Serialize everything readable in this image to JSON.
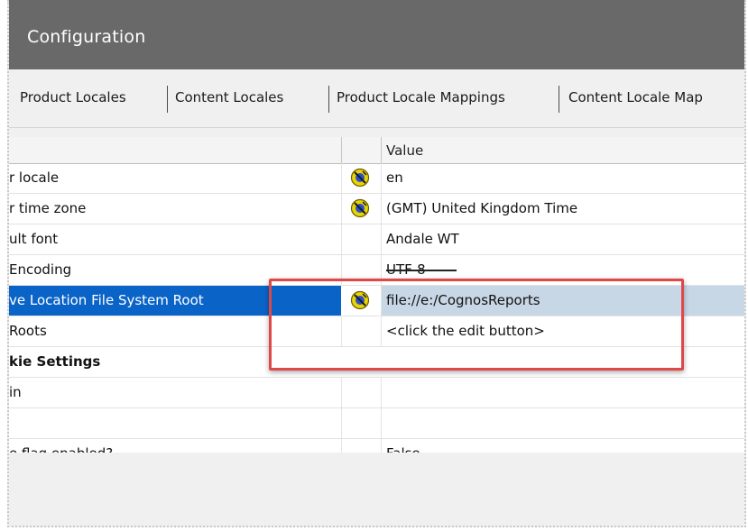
{
  "window": {
    "title": "Configuration"
  },
  "tabs": [
    {
      "label": "Product Locales"
    },
    {
      "label": "Content Locales"
    },
    {
      "label": "Product Locale Mappings"
    },
    {
      "label": "Content Locale Map"
    }
  ],
  "grid": {
    "value_header": "Value",
    "rows": [
      {
        "name": "r locale",
        "value": "en",
        "icon": "settings-edit-icon",
        "bold": false,
        "selected": false
      },
      {
        "name": "r time zone",
        "value": "(GMT) United Kingdom Time",
        "icon": "settings-edit-icon",
        "bold": false,
        "selected": false
      },
      {
        "name": "ult font",
        "value": "Andale WT",
        "icon": "",
        "bold": false,
        "selected": false
      },
      {
        "name": "Encoding",
        "value": "UTF-8",
        "icon": "",
        "bold": false,
        "selected": false
      },
      {
        "name": "ve Location File System Root",
        "value": "file://e:/CognosReports",
        "icon": "settings-edit-icon",
        "bold": false,
        "selected": true
      },
      {
        "name": "Roots",
        "value": "<click the edit button>",
        "icon": "",
        "bold": false,
        "selected": false
      },
      {
        "name": "kie Settings",
        "value": "",
        "icon": "",
        "bold": true,
        "selected": false
      },
      {
        "name": "in",
        "value": "",
        "icon": "",
        "bold": false,
        "selected": false
      },
      {
        "name": "",
        "value": "",
        "icon": "",
        "bold": false,
        "selected": false
      },
      {
        "name": "e flag enabled?",
        "value": "False",
        "icon": "",
        "bold": false,
        "selected": false
      }
    ]
  },
  "colors": {
    "titlebar": "#696969",
    "selection": "#0a64c8",
    "highlight_box": "#e04848"
  }
}
